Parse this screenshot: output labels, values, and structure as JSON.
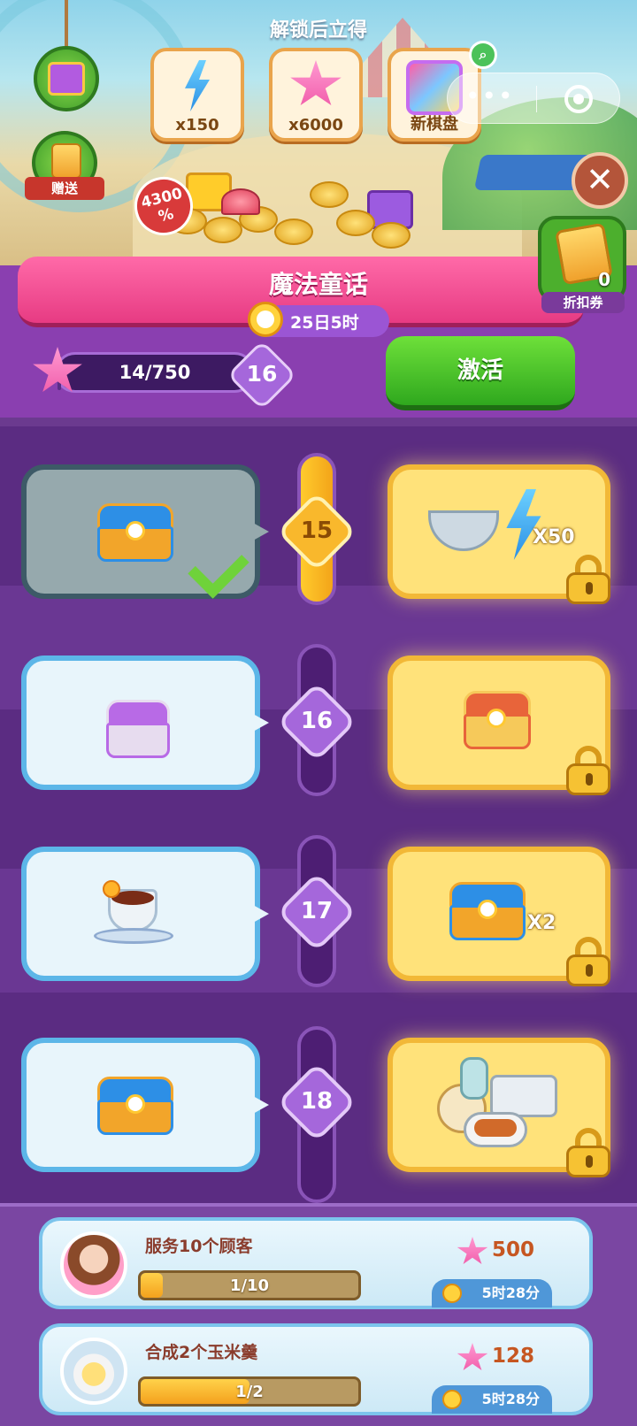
{
  "header": {
    "unlock_title": "解锁后立得",
    "rewards": [
      {
        "icon": "lightning-icon",
        "label": "x150"
      },
      {
        "icon": "pink-star-icon",
        "label": "x6000"
      },
      {
        "icon": "new-board-icon",
        "label": "新棋盘"
      }
    ],
    "send_label": "赠送",
    "discount_badge": "4300\n%",
    "close_icon": "close-icon"
  },
  "event": {
    "title": "魔法童话",
    "timer": "25日5时",
    "coupon_count": "0",
    "coupon_label": "折扣券"
  },
  "progress": {
    "text": "14/750",
    "current": 14,
    "max": 750,
    "level": "16",
    "activate_label": "激活"
  },
  "track": [
    {
      "level": "15",
      "reached": true,
      "free": {
        "icon": "blue-chest-icon",
        "claimed": true
      },
      "premium": {
        "icon": "bowl-and-lightning-icon",
        "mult": "X50"
      }
    },
    {
      "level": "16",
      "reached": false,
      "free": {
        "icon": "purple-chest-icon"
      },
      "premium": {
        "icon": "red-chest-icon",
        "mult": ""
      }
    },
    {
      "level": "17",
      "reached": false,
      "free": {
        "icon": "tea-cup-icon"
      },
      "premium": {
        "icon": "blue-chest-icon",
        "mult": "X2"
      }
    },
    {
      "level": "18",
      "reached": false,
      "free": {
        "icon": "blue-chest-icon"
      },
      "premium": {
        "icon": "bento-set-icon",
        "mult": ""
      }
    }
  ],
  "tasks": [
    {
      "title": "服务10个顾客",
      "progress_text": "1/10",
      "progress": 0.1,
      "points": "500",
      "time": "5时28分",
      "icon": "customer-avatar-icon"
    },
    {
      "title": "合成2个玉米羹",
      "progress_text": "1/2",
      "progress": 0.5,
      "points": "128",
      "time": "5时28分",
      "icon": "corn-soup-icon"
    }
  ],
  "colors": {
    "accent_pink": "#e73b83",
    "button_green": "#2fa81e",
    "track_purple": "#6a3793"
  }
}
